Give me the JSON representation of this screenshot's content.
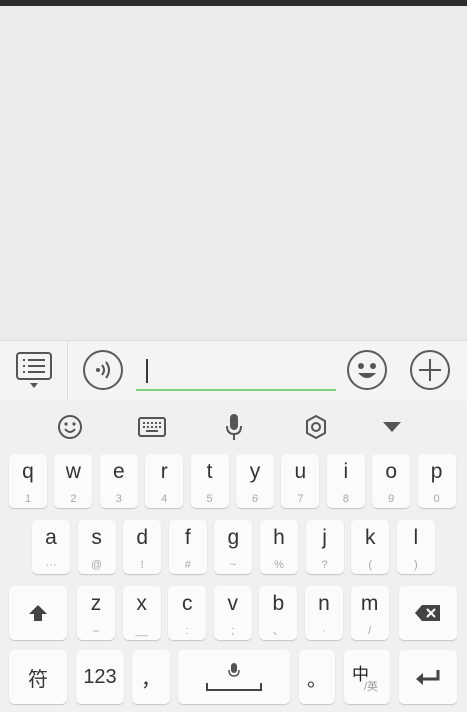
{
  "input_bar": {
    "message_value": "",
    "icons": {
      "menu": "menu-list-icon",
      "voice": "voice-icon",
      "emoji": "emoji-icon",
      "add": "plus-icon"
    }
  },
  "keyboard": {
    "toolbar": [
      {
        "name": "emoji-panel-icon"
      },
      {
        "name": "keyboard-icon"
      },
      {
        "name": "microphone-icon"
      },
      {
        "name": "settings-icon"
      },
      {
        "name": "collapse-keyboard-icon"
      }
    ],
    "row1": [
      {
        "main": "q",
        "sub": "1"
      },
      {
        "main": "w",
        "sub": "2"
      },
      {
        "main": "e",
        "sub": "3"
      },
      {
        "main": "r",
        "sub": "4"
      },
      {
        "main": "t",
        "sub": "5"
      },
      {
        "main": "y",
        "sub": "6"
      },
      {
        "main": "u",
        "sub": "7"
      },
      {
        "main": "i",
        "sub": "8"
      },
      {
        "main": "o",
        "sub": "9"
      },
      {
        "main": "p",
        "sub": "0"
      }
    ],
    "row2": [
      {
        "main": "a",
        "sub": "···"
      },
      {
        "main": "s",
        "sub": "@"
      },
      {
        "main": "d",
        "sub": "!"
      },
      {
        "main": "f",
        "sub": "#"
      },
      {
        "main": "g",
        "sub": "~"
      },
      {
        "main": "h",
        "sub": "%"
      },
      {
        "main": "j",
        "sub": "?"
      },
      {
        "main": "k",
        "sub": "("
      },
      {
        "main": "l",
        "sub": ")"
      }
    ],
    "row3": [
      {
        "main": "z",
        "sub": "–"
      },
      {
        "main": "x",
        "sub": "__"
      },
      {
        "main": "c",
        "sub": ":"
      },
      {
        "main": "v",
        "sub": ";"
      },
      {
        "main": "b",
        "sub": "、"
      },
      {
        "main": "n",
        "sub": "·"
      },
      {
        "main": "m",
        "sub": "/"
      }
    ],
    "row4": {
      "symbols_label": "符",
      "numbers_label": "123",
      "comma_label": "，",
      "period_label": "。",
      "lang_main": "中",
      "lang_sub": "/英"
    },
    "icons": {
      "shift": "shift-icon",
      "backspace": "backspace-icon",
      "space": "space-mic-icon",
      "enter": "enter-icon"
    }
  }
}
